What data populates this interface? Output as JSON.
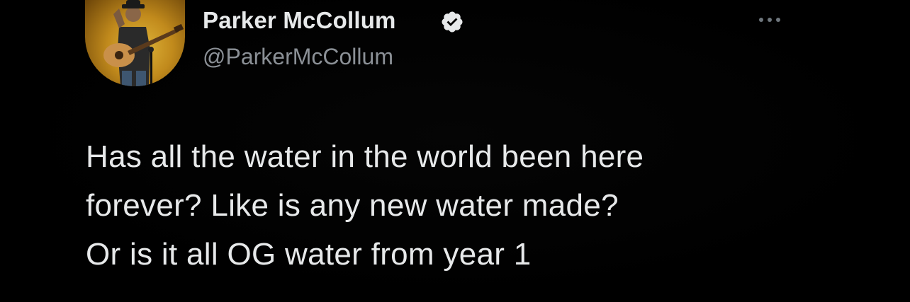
{
  "author": {
    "display_name": "Parker McCollum",
    "handle": "@ParkerMcCollum",
    "verified": true,
    "avatar_icon": "avatar-photo-guitarist",
    "verified_icon": "verified-badge-icon"
  },
  "tweet": {
    "lines": [
      "Has all the water in the world been here",
      "forever? Like is any new water made?",
      "Or is it all OG water from year 1"
    ]
  },
  "actions": {
    "more_icon": "more-options-icon"
  },
  "colors": {
    "background": "#000000",
    "primary_text": "#e7e9ea",
    "secondary_text": "#8b9096",
    "icon": "#6e767d"
  }
}
